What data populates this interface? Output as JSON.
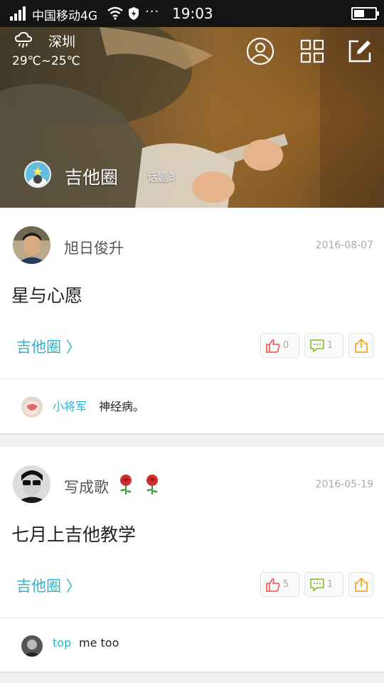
{
  "status_bar": {
    "carrier": "中国移动4G",
    "time": "19:03",
    "more": "···"
  },
  "header": {
    "weather": {
      "city": "深圳",
      "temperature": "29℃~25℃",
      "icon": "rain-cloud-icon"
    },
    "buttons": [
      {
        "name": "profile-button",
        "icon": "user-circle-icon"
      },
      {
        "name": "grid-button",
        "icon": "grid-icon"
      },
      {
        "name": "compose-button",
        "icon": "edit-icon"
      }
    ],
    "circle": {
      "title": "吉他圈",
      "topics": "话题3"
    }
  },
  "colors": {
    "accent": "#2bb5cc",
    "like": "#e8554f",
    "comment": "#8dc63f",
    "share": "#f5a623"
  },
  "posts": [
    {
      "author": "旭日俊升",
      "date": "2016-08-07",
      "title": "星与心愿",
      "circle_link": "吉他圈 〉",
      "likes": "0",
      "comments": "1",
      "comment": {
        "user": "小将军",
        "text": "神经病。"
      }
    },
    {
      "author": "写成歌",
      "date": "2016-05-19",
      "title": "七月上吉他教学",
      "circle_link": "吉他圈 〉",
      "likes": "5",
      "comments": "1",
      "comment": {
        "user": "top",
        "text": "me too"
      }
    }
  ]
}
